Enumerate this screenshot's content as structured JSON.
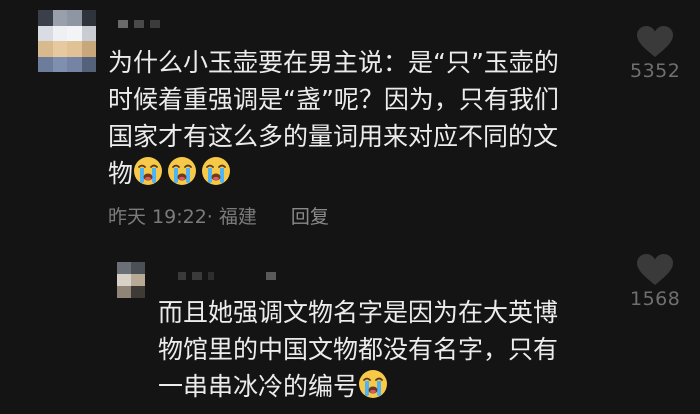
{
  "comment": {
    "text": "为什么小玉壶要在男主说：是“只”玉壶的\n时候着重强调是“盏”呢？因为，只有我们\n国家才有这么多的量词用来对应不同的文\n物",
    "emoji_count": 3,
    "date": "昨天 19:22",
    "location": "· 福建",
    "reply_label": "回复",
    "like_count": "5352"
  },
  "reply": {
    "text": "而且她强调文物名字是因为在大英博\n物馆里的中国文物都没有名字，只有\n一串串冰冷的编号",
    "emoji_count": 1,
    "like_count": "1568"
  },
  "icons": {
    "like": "heart-icon",
    "emoji": "loudly-crying-face-icon"
  },
  "colors": {
    "background": "#141414",
    "text": "#ececec",
    "meta": "#7b7b7b",
    "heart": "#3a3a3a"
  }
}
